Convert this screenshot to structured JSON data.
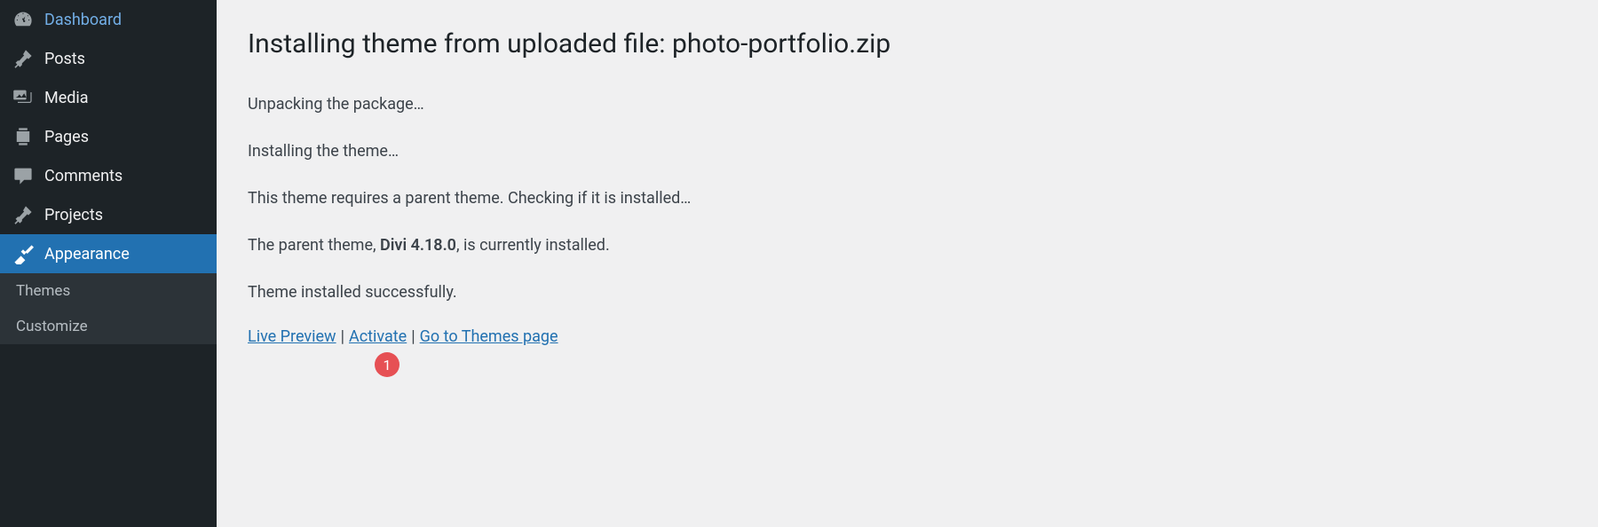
{
  "sidebar": {
    "items": [
      {
        "label": "Dashboard"
      },
      {
        "label": "Posts"
      },
      {
        "label": "Media"
      },
      {
        "label": "Pages"
      },
      {
        "label": "Comments"
      },
      {
        "label": "Projects"
      },
      {
        "label": "Appearance"
      }
    ],
    "submenu": [
      {
        "label": "Themes"
      },
      {
        "label": "Customize"
      }
    ]
  },
  "main": {
    "title": "Installing theme from uploaded file: photo-portfolio.zip",
    "status_lines": {
      "unpacking": "Unpacking the package…",
      "installing": "Installing the theme…",
      "parent_check": "This theme requires a parent theme. Checking if it is installed…",
      "parent_prefix": "The parent theme, ",
      "parent_name": "Divi 4.18.0",
      "parent_suffix": ", is currently installed.",
      "success": "Theme installed successfully."
    },
    "actions": {
      "live_preview": "Live Preview",
      "activate": "Activate",
      "go_themes": "Go to Themes page"
    },
    "badge": "1"
  }
}
